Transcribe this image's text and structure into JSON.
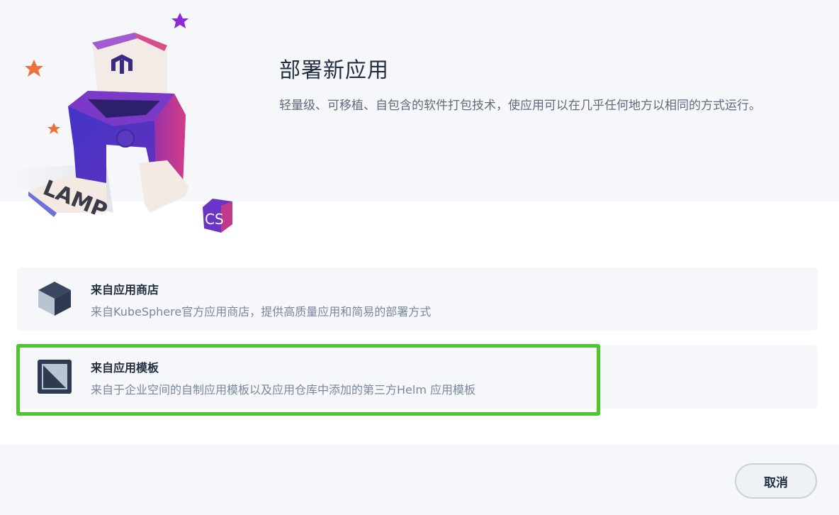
{
  "header": {
    "title": "部署新应用",
    "description": "轻量级、可移植、自包含的软件打包技术，使应用可以在几乎任何地方以相同的方式运行。"
  },
  "illustration": {
    "box_letters": "LAMP",
    "badge_letters": "CS",
    "colors": {
      "accent_purple": "#5b3ccf",
      "magenta": "#c03a8c",
      "star_orange": "#f0703c",
      "star_purple": "#8a2bd6"
    }
  },
  "options": [
    {
      "icon": "cube-icon",
      "title": "来自应用商店",
      "description": "来自KubeSphere官方应用商店，提供高质量应用和简易的部署方式"
    },
    {
      "icon": "template-icon",
      "title": "来自应用模板",
      "description": "来自于企业空间的自制应用模板以及应用仓库中添加的第三方Helm 应用模板",
      "highlighted": true
    }
  ],
  "footer": {
    "cancel_label": "取消"
  },
  "colors": {
    "highlight_border": "#4cc82e",
    "panel_bg": "#f5f7fa",
    "text_primary": "#242e42",
    "text_secondary": "#79879c"
  }
}
